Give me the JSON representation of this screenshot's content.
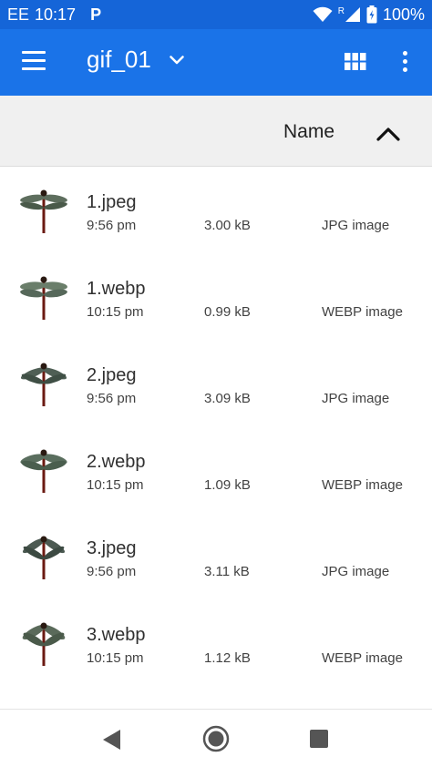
{
  "status_bar": {
    "carrier": "EE",
    "time": "10:17",
    "notification_icon": "parking-p-icon",
    "notification_letter": "P",
    "battery": "100%",
    "icons": [
      "wifi-icon",
      "signal-icon",
      "battery-icon"
    ],
    "roaming_letter": "R"
  },
  "app_bar": {
    "title": "gif_01",
    "menu_icon": "hamburger-menu-icon",
    "dropdown_icon": "chevron-down-icon",
    "grid_icon": "grid-view-icon",
    "overflow_icon": "more-vert-icon",
    "color": "#1a73e8"
  },
  "sort_header": {
    "label": "Name",
    "direction_icon": "chevron-up-icon"
  },
  "files": [
    {
      "name": "1.jpeg",
      "time": "9:56 pm",
      "size": "3.00 kB",
      "type": "JPG image"
    },
    {
      "name": "1.webp",
      "time": "10:15 pm",
      "size": "0.99 kB",
      "type": "WEBP image"
    },
    {
      "name": "2.jpeg",
      "time": "9:56 pm",
      "size": "3.09 kB",
      "type": "JPG image"
    },
    {
      "name": "2.webp",
      "time": "10:15 pm",
      "size": "1.09 kB",
      "type": "WEBP image"
    },
    {
      "name": "3.jpeg",
      "time": "9:56 pm",
      "size": "3.11 kB",
      "type": "JPG image"
    },
    {
      "name": "3.webp",
      "time": "10:15 pm",
      "size": "1.12 kB",
      "type": "WEBP image"
    }
  ],
  "thumbnail_icon": "dragonfly-thumbnail-icon",
  "nav_bar": {
    "back_icon": "back-triangle-icon",
    "home_icon": "home-circle-icon",
    "recents_icon": "recents-square-icon"
  }
}
